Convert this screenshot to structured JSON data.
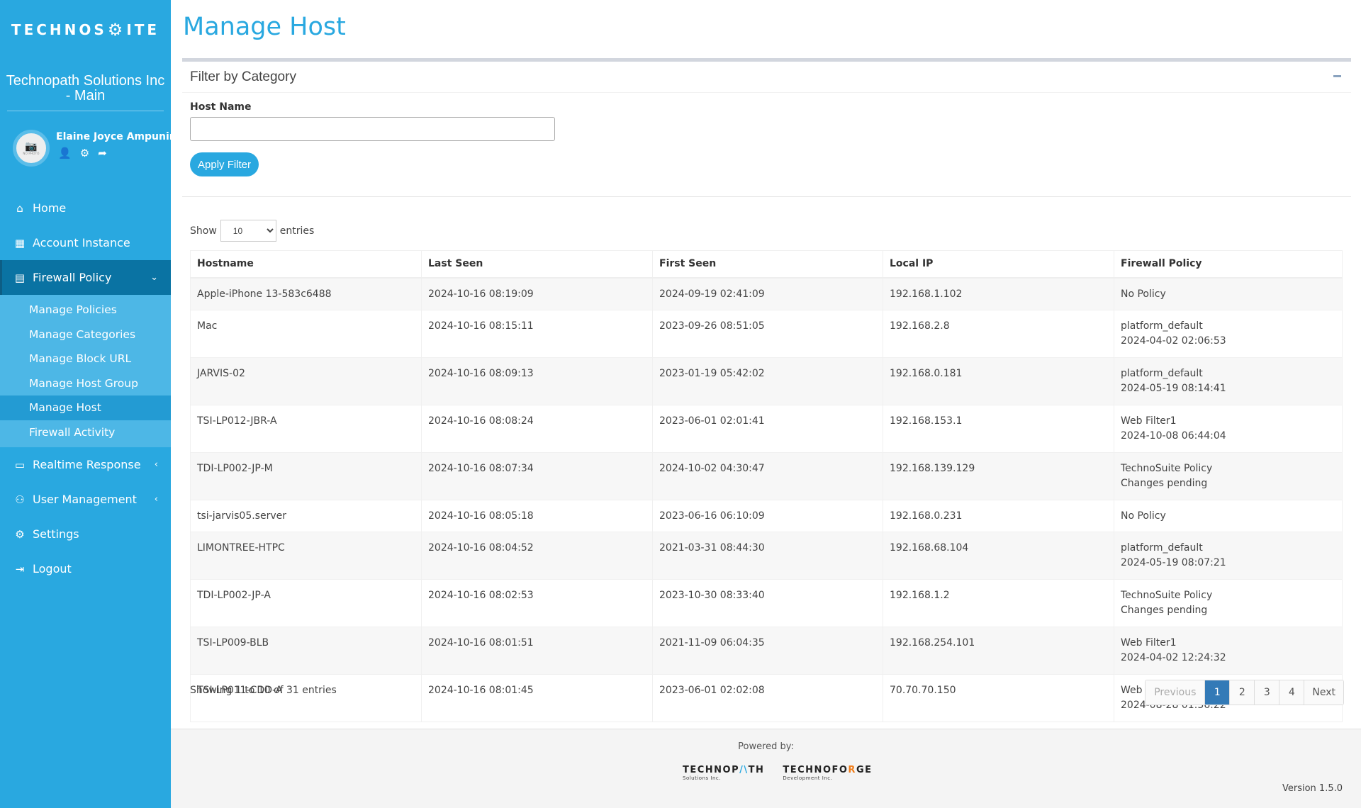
{
  "brand": {
    "logo_text_left": "TECHNOS",
    "logo_text_right": "ITE"
  },
  "sidebar": {
    "company": "Technopath Solutions Inc - Main",
    "user": {
      "name": "Elaine Joyce Ampunin",
      "avatar_text": "NO PHOTO"
    },
    "items": [
      {
        "label": "Home",
        "icon": "home-icon"
      },
      {
        "label": "Account Instance",
        "icon": "building-icon"
      },
      {
        "label": "Firewall Policy",
        "icon": "firewall-icon",
        "expanded": true,
        "children": [
          {
            "label": "Manage Policies"
          },
          {
            "label": "Manage Categories"
          },
          {
            "label": "Manage Block URL"
          },
          {
            "label": "Manage Host Group"
          },
          {
            "label": "Manage Host",
            "active": true
          },
          {
            "label": "Firewall Activity"
          }
        ]
      },
      {
        "label": "Realtime Response",
        "icon": "terminal-icon"
      },
      {
        "label": "User Management",
        "icon": "users-gear-icon"
      },
      {
        "label": "Settings",
        "icon": "gear-icon"
      },
      {
        "label": "Logout",
        "icon": "logout-icon"
      }
    ]
  },
  "page": {
    "title": "Manage Host"
  },
  "filter": {
    "title": "Filter by Category",
    "host_name_label": "Host Name",
    "host_name_value": "",
    "apply_label": "Apply Filter"
  },
  "table_controls": {
    "show_label": "Show",
    "entries_label": "entries",
    "page_length": "10"
  },
  "table": {
    "columns": [
      "Hostname",
      "Last Seen",
      "First Seen",
      "Local IP",
      "Firewall Policy"
    ],
    "rows": [
      {
        "hostname": "Apple-iPhone 13-583c6488",
        "last_seen": "2024-10-16 08:19:09",
        "first_seen": "2024-09-19 02:41:09",
        "local_ip": "192.168.1.102",
        "policy": "No Policy",
        "policy_sub": ""
      },
      {
        "hostname": "Mac",
        "last_seen": "2024-10-16 08:15:11",
        "first_seen": "2023-09-26 08:51:05",
        "local_ip": "192.168.2.8",
        "policy": "platform_default",
        "policy_sub": "2024-04-02 02:06:53"
      },
      {
        "hostname": "JARVIS-02",
        "last_seen": "2024-10-16 08:09:13",
        "first_seen": "2023-01-19 05:42:02",
        "local_ip": "192.168.0.181",
        "policy": "platform_default",
        "policy_sub": "2024-05-19 08:14:41"
      },
      {
        "hostname": "TSI-LP012-JBR-A",
        "last_seen": "2024-10-16 08:08:24",
        "first_seen": "2023-06-01 02:01:41",
        "local_ip": "192.168.153.1",
        "policy": "Web Filter1",
        "policy_sub": "2024-10-08 06:44:04"
      },
      {
        "hostname": "TDI-LP002-JP-M",
        "last_seen": "2024-10-16 08:07:34",
        "first_seen": "2024-10-02 04:30:47",
        "local_ip": "192.168.139.129",
        "policy": "TechnoSuite Policy",
        "policy_sub": "Changes pending"
      },
      {
        "hostname": "tsi-jarvis05.server",
        "last_seen": "2024-10-16 08:05:18",
        "first_seen": "2023-06-16 06:10:09",
        "local_ip": "192.168.0.231",
        "policy": "No Policy",
        "policy_sub": ""
      },
      {
        "hostname": "LIMONTREE-HTPC",
        "last_seen": "2024-10-16 08:04:52",
        "first_seen": "2021-03-31 08:44:30",
        "local_ip": "192.168.68.104",
        "policy": "platform_default",
        "policy_sub": "2024-05-19 08:07:21"
      },
      {
        "hostname": "TDI-LP002-JP-A",
        "last_seen": "2024-10-16 08:02:53",
        "first_seen": "2023-10-30 08:33:40",
        "local_ip": "192.168.1.2",
        "policy": "TechnoSuite Policy",
        "policy_sub": "Changes pending"
      },
      {
        "hostname": "TSI-LP009-BLB",
        "last_seen": "2024-10-16 08:01:51",
        "first_seen": "2021-11-09 06:04:35",
        "local_ip": "192.168.254.101",
        "policy": "Web Filter1",
        "policy_sub": "2024-04-02 12:24:32"
      },
      {
        "hostname": "TSI-LP011-CDD-A",
        "last_seen": "2024-10-16 08:01:45",
        "first_seen": "2023-06-01 02:02:08",
        "local_ip": "70.70.70.150",
        "policy": "Web Filter1",
        "policy_sub": "2024-08-28 01:36:22"
      }
    ]
  },
  "pagination": {
    "info": "Showing 1 to 10 of 31 entries",
    "previous": "Previous",
    "pages": [
      "1",
      "2",
      "3",
      "4"
    ],
    "current": "1",
    "next": "Next"
  },
  "footer": {
    "powered_by": "Powered by:",
    "logo1_main_a": "TECHNOP",
    "logo1_accent": "/\\",
    "logo1_main_b": "TH",
    "logo1_sub": "Solutions Inc.",
    "logo2_main_a": "TECHNOFO",
    "logo2_accent": "R",
    "logo2_main_b": "GE",
    "logo2_sub": "Development Inc.",
    "version": "Version 1.5.0"
  },
  "colors": {
    "primary": "#29a8e0",
    "sidebar_open": "#0a73a3",
    "pagination_active": "#337ab7"
  }
}
